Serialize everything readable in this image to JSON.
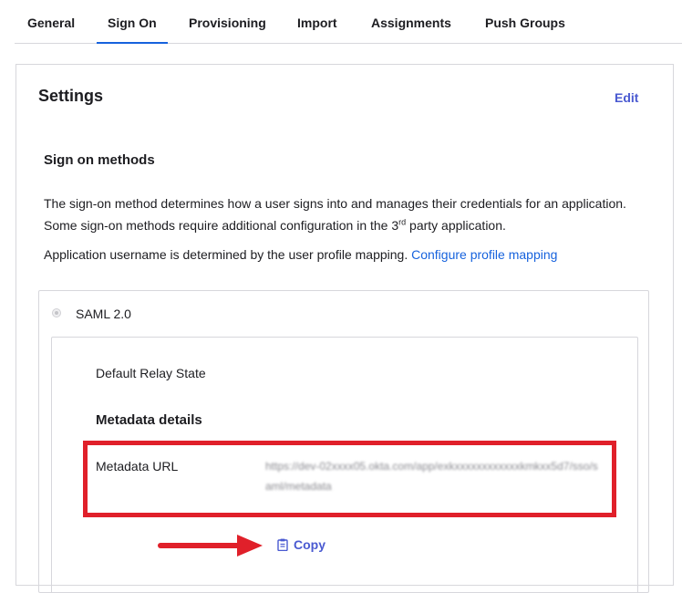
{
  "tabs": [
    {
      "label": "General"
    },
    {
      "label": "Sign On",
      "active": true
    },
    {
      "label": "Provisioning"
    },
    {
      "label": "Import"
    },
    {
      "label": "Assignments"
    },
    {
      "label": "Push Groups"
    }
  ],
  "settings": {
    "title": "Settings",
    "edit_label": "Edit"
  },
  "sign_on": {
    "section_title": "Sign on methods",
    "description_part1": "The sign-on method determines how a user signs into and manages their credentials for an application. Some sign-on methods require additional configuration in the 3",
    "description_sup": "rd",
    "description_part2": " party application.",
    "mapping_text": "Application username is determined by the user profile mapping. ",
    "mapping_link": "Configure profile mapping"
  },
  "saml": {
    "option_label": "SAML 2.0",
    "relay_state_label": "Default Relay State",
    "metadata_title": "Metadata details",
    "metadata_url_label": "Metadata URL",
    "metadata_url_value": "https://dev-02xxxx05.okta.com/app/exkxxxxxxxxxxxxkmkxx5d7/sso/saml/metadata",
    "copy_label": "Copy"
  },
  "colors": {
    "accent": "#1662dd",
    "link_button": "#4a5ad1",
    "annotation_red": "#e0202a"
  },
  "icons": {
    "copy": "clipboard-icon",
    "radio": "radio-icon",
    "annotation": "arrow-right-icon"
  }
}
